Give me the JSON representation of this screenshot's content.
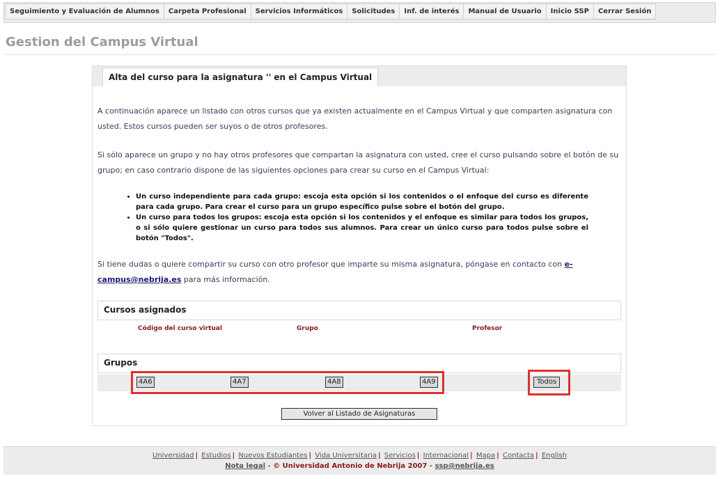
{
  "nav": {
    "items": [
      "Seguimiento y Evaluación de Alumnos",
      "Carpeta Profesional",
      "Servicios Informáticos",
      "Solicitudes",
      "Inf. de interés",
      "Manual de Usuario",
      "Inicio SSP",
      "Cerrar Sesión"
    ]
  },
  "page": {
    "title": "Gestion del Campus Virtual"
  },
  "panel": {
    "title": "Alta del curso para la asignatura '' en el Campus Virtual",
    "intro": "A continuación aparece un listado con otros cursos que ya existen actualmente en el Campus Virtual y que comparten asignatura con usted. Estos cursos pueden ser suyos o de otros profesores.",
    "instructions": "Si sólo aparece un grupo y no hay otros profesores que compartan la asignatura con usted, cree el curso pulsando sobre el botón de su grupo; en caso contrario dispone de las siguientes opciones para crear su curso en el Campus Virtual:",
    "options": [
      "Un curso independiente para cada grupo: escoja esta opción si los contenidos o el enfoque del curso es diferente para cada grupo. Para crear el curso para un grupo específico pulse sobre el botón del grupo.",
      "Un curso para todos los grupos: escoja esta opción si los contenidos y el enfoque es similar para todos los grupos, o si sólo quiere gestionar un curso para todos sus alumnos. Para crear un único curso para todos pulse sobre el botón \"Todos\"."
    ],
    "contact_prefix": "Si tiene dudas o quiere compartir su curso con otro profesor que imparte su misma asignatura, póngase en contacto con ",
    "contact_email": "e-campus@nebrija.es",
    "contact_suffix": " para más información."
  },
  "assigned": {
    "heading": "Cursos asignados",
    "columns": [
      "Código del curso virtual",
      "Grupo",
      "Profesor"
    ]
  },
  "groups": {
    "heading": "Grupos",
    "buttons": [
      "4A6",
      "4A7",
      "4A8",
      "4A9"
    ],
    "all_button": "Todos"
  },
  "back_button": "Volver al Listado de Asignaturas",
  "footer": {
    "links": [
      "Universidad",
      "Estudios",
      "Nuevos Estudiantes",
      "Vida Universitaria",
      "Servicios",
      "Internacional",
      "Mapa",
      "Contacta",
      "English"
    ],
    "legal_link": "Nota legal",
    "copyright": "© Universidad Antonio de Nebrija 2007",
    "email": "ssp@nebrija.es"
  },
  "colors": {
    "highlight": "#e0302b",
    "column_header": "#8b1a1a",
    "title_gray": "#9c9c9c"
  }
}
